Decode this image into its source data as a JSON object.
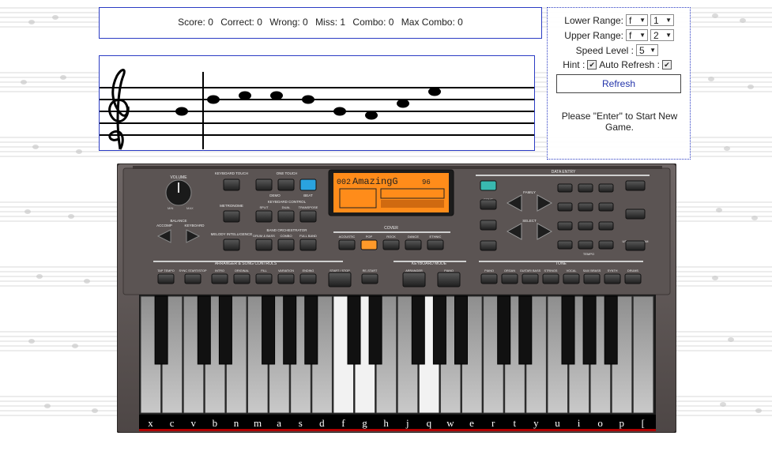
{
  "score": {
    "score_label": "Score: 0",
    "correct_label": "Correct: 0",
    "wrong_label": "Wrong: 0",
    "miss_label": "Miss: 1",
    "combo_label": "Combo: 0",
    "max_combo_label": "Max Combo: 0"
  },
  "controls": {
    "lower_range_label": "Lower Range:",
    "lower_note": "f",
    "lower_octave": "1",
    "upper_range_label": "Upper Range:",
    "upper_note": "f",
    "upper_octave": "2",
    "speed_label": "Speed Level :",
    "speed_value": "5",
    "hint_label": "Hint :",
    "hint_checked": true,
    "auto_refresh_label": "Auto Refresh :",
    "auto_refresh_checked": true,
    "refresh_button": "Refresh",
    "start_message": "Please \"Enter\" to Start New Game."
  },
  "instrument": {
    "volume_label": "VOLUME",
    "min_label": "MIN",
    "max_label": "MAX",
    "balance_label": "BALANCE",
    "accomp_label": "ACCOMP",
    "keyboard_label": "KEYBOARD",
    "keyboard_touch_label": "KEYBOARD TOUCH",
    "metronome_label": "METRONOME",
    "melody_intelligence_label": "MELODY INTELLIGENCE",
    "one_touch_label": "ONE TOUCH",
    "demo_label": "DEMO",
    "beat_label": "BEAT",
    "keyboard_control_label": "KEYBOARD CONTROL",
    "split_label": "SPLIT",
    "dual_label": "DUAL",
    "transpose_label": "TRANSPOSE",
    "band_orchestrator_label": "BAND ORCHESTRATOR",
    "drum_bass_label": "DRUM & BASS",
    "combo_label": "COMBO",
    "full_band_label": "FULL BAND",
    "display_text": "AmazingG",
    "display_number": "002",
    "tempo_value": "96",
    "cover_label": "COVER",
    "cover_styles": [
      "ACOUSTIC",
      "POP",
      "ROCK",
      "DANCE",
      "ETHNIC"
    ],
    "data_entry_label": "DATA ENTRY",
    "song_label": "SONG",
    "style_label": "STYLE",
    "tone_label_btn": "TONE",
    "family_label": "FAMILY",
    "select_label": "SELECT",
    "function_label": "FUNCTION",
    "disk_label": "DISK",
    "user_program_label": "USER PROGRAM",
    "tempo_label": "TEMPO",
    "arranger_label": "ARRANGER & SONG CONTROLS",
    "arranger_buttons": [
      "TAP TEMPO",
      "SYNC START/STOP",
      "INTRO",
      "ORIGINAL",
      "FILL",
      "VARIATION",
      "ENDING"
    ],
    "start_stop_label": "START / STOP",
    "restart_label": "RE-START",
    "keyboard_mode_label": "KEYBOARD MODE",
    "arranger_mode": "ARRANGER",
    "piano_mode": "PIANO",
    "tone_section_label": "TONE",
    "tone_buttons": [
      "PIANO",
      "ORGAN",
      "GUITAR/ BASS",
      "STRINGS",
      "VOCAL",
      "SAX/ BRASS",
      "SYNTH",
      "DRUMS"
    ],
    "key_labels": [
      "x",
      "c",
      "v",
      "b",
      "n",
      "m",
      "a",
      "s",
      "d",
      "f",
      "g",
      "h",
      "j",
      "q",
      "w",
      "e",
      "r",
      "t",
      "y",
      "u",
      "i",
      "o",
      "p",
      "["
    ]
  },
  "colors": {
    "panel_border": "#2b3cc4",
    "display_orange": "#ff8c1a",
    "highlight_blue": "#2aa3e0",
    "key_strip_red": "#b00000"
  }
}
